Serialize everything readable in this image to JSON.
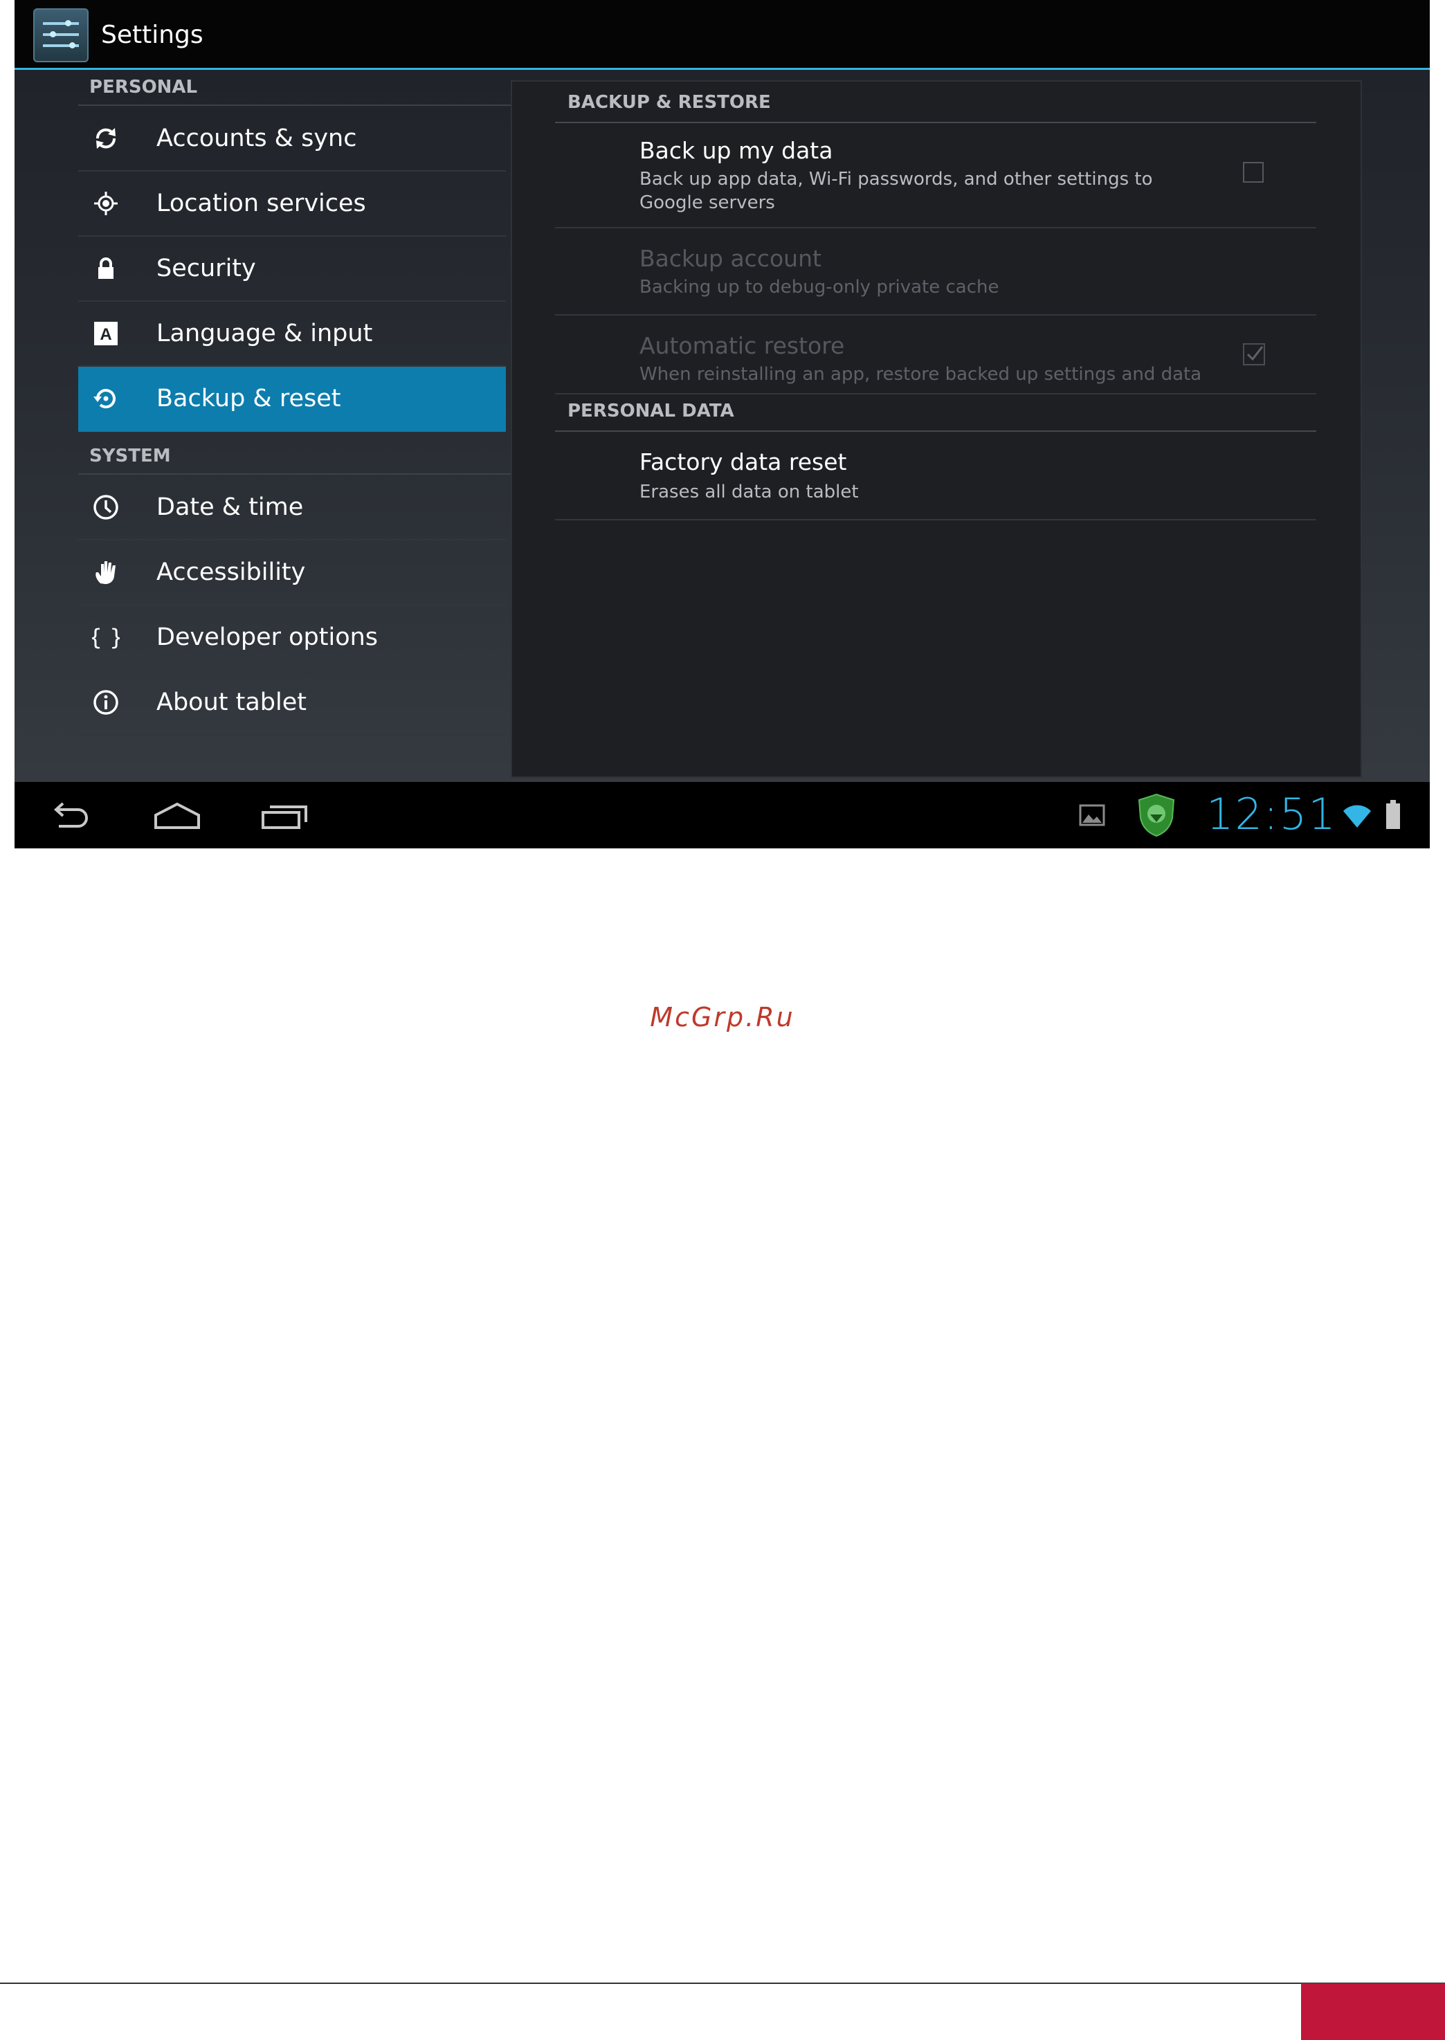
{
  "action_bar": {
    "title": "Settings",
    "accent": "#33b5e5"
  },
  "left_pane": {
    "personal_header": "PERSONAL",
    "personal_items": [
      {
        "label": "Accounts & sync",
        "icon": "sync-icon"
      },
      {
        "label": "Location services",
        "icon": "location-icon"
      },
      {
        "label": "Security",
        "icon": "lock-icon"
      },
      {
        "label": "Language & input",
        "icon": "language-icon"
      },
      {
        "label": "Backup & reset",
        "icon": "backup-icon",
        "selected": true
      }
    ],
    "system_header": "SYSTEM",
    "system_items": [
      {
        "label": "Date & time",
        "icon": "clock-icon"
      },
      {
        "label": "Accessibility",
        "icon": "hand-icon"
      },
      {
        "label": "Developer options",
        "icon": "braces-icon"
      },
      {
        "label": "About tablet",
        "icon": "info-icon"
      }
    ],
    "selected_color": "#0d7dae"
  },
  "detail": {
    "backup_header": "BACKUP & RESTORE",
    "backup_items": [
      {
        "title": "Back up my data",
        "summary": "Back up app data, Wi-Fi passwords, and other settings to Google servers",
        "checked": false,
        "enabled": true
      },
      {
        "title": "Backup account",
        "summary": "Backing up to debug-only private cache",
        "enabled": false
      },
      {
        "title": "Automatic restore",
        "summary": "When reinstalling an app, restore backed up settings and data",
        "checked": true,
        "enabled": false
      }
    ],
    "personal_data_header": "PERSONAL DATA",
    "personal_data_items": [
      {
        "title": "Factory data reset",
        "summary": "Erases all data on tablet"
      }
    ]
  },
  "nav_bar": {
    "buttons": [
      "back-icon",
      "home-icon",
      "recent-apps-icon"
    ],
    "status_icons": [
      "picture-notification-icon",
      "security-shield-icon",
      "wifi-icon",
      "battery-icon"
    ],
    "clock": "12:51"
  },
  "watermark": "McGrp.Ru",
  "footer_accent": "#c0163a"
}
